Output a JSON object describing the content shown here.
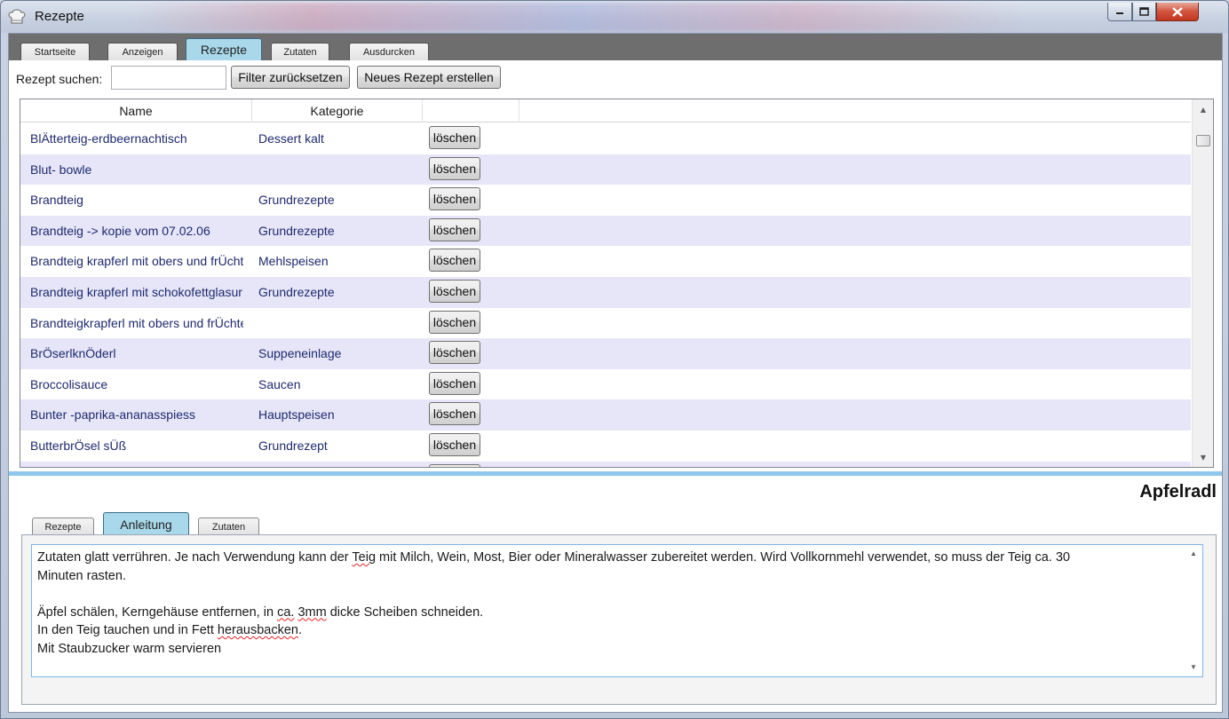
{
  "window": {
    "title": "Rezepte"
  },
  "main_tabs": [
    {
      "label": "Startseite"
    },
    {
      "label": "Anzeigen"
    },
    {
      "label": "Rezepte"
    },
    {
      "label": "Zutaten"
    },
    {
      "label": "Ausdurcken"
    }
  ],
  "toolbar": {
    "search_label": "Rezept suchen:",
    "search_value": "",
    "reset_label": "Filter zurücksetzen",
    "new_label": "Neues Rezept erstellen"
  },
  "grid": {
    "columns": [
      "Name",
      "Kategorie",
      ""
    ],
    "rows": [
      {
        "name": "BlÄtterteig-erdbeernachtisch",
        "category": "Dessert kalt",
        "action": "löschen"
      },
      {
        "name": "Blut- bowle",
        "category": "",
        "action": "löschen"
      },
      {
        "name": "Brandteig",
        "category": "Grundrezepte",
        "action": "löschen"
      },
      {
        "name": "Brandteig -> kopie vom 07.02.06",
        "category": "Grundrezepte",
        "action": "löschen"
      },
      {
        "name": "Brandteig krapferl mit obers und frÜchten",
        "category": "Mehlspeisen",
        "action": "löschen"
      },
      {
        "name": "Brandteig krapferl mit schokofettglasur",
        "category": "Grundrezepte",
        "action": "löschen"
      },
      {
        "name": "Brandteigkrapferl  mit obers und frÜchten",
        "category": "",
        "action": "löschen"
      },
      {
        "name": "BrÖserlknÖderl",
        "category": "Suppeneinlage",
        "action": "löschen"
      },
      {
        "name": "Broccolisauce",
        "category": "Saucen",
        "action": "löschen"
      },
      {
        "name": "Bunter -paprika-ananasspiess",
        "category": "Hauptspeisen",
        "action": "löschen"
      },
      {
        "name": "ButterbrÖsel  sÜß",
        "category": "Grundrezept",
        "action": "löschen"
      },
      {
        "name": "",
        "category": "",
        "action": ""
      }
    ]
  },
  "recipe": {
    "title": "Apfelradl"
  },
  "detail_tabs": [
    {
      "label": "Rezepte"
    },
    {
      "label": "Anleitung"
    },
    {
      "label": "Zutaten"
    }
  ],
  "instructions": {
    "l1a": "Zutaten glatt verrühren.  Je nach Verwendung kann der ",
    "l1w": "Teig",
    "l1b": " mit Milch, Wein, Most, Bier oder Mineralwasser zubereitet werden. Wird Vollkornmehl verwendet, so muss der Teig ca. 30",
    "l2": "Minuten rasten.",
    "l3": "",
    "l4a": "Äpfel schälen, Kerngehäuse entfernen, in ",
    "l4w1": "ca.",
    "l4m": " ",
    "l4w2": "3mm",
    "l4b": " dicke Scheiben schneiden.",
    "l5a": "In den Teig tauchen und in Fett ",
    "l5w": "herausbacken",
    "l5b": ".",
    "l6": "Mit Staubzucker warm servieren"
  },
  "colors": {
    "active_tab": "#a8d8ea",
    "row_alt": "#e6e6f8",
    "splitter": "#8ec8ec",
    "row_text": "#1f2a6e"
  },
  "icons": [
    "chef-hat-icon",
    "minimize-icon",
    "maximize-icon",
    "close-icon",
    "scroll-up-icon",
    "scroll-down-icon"
  ]
}
